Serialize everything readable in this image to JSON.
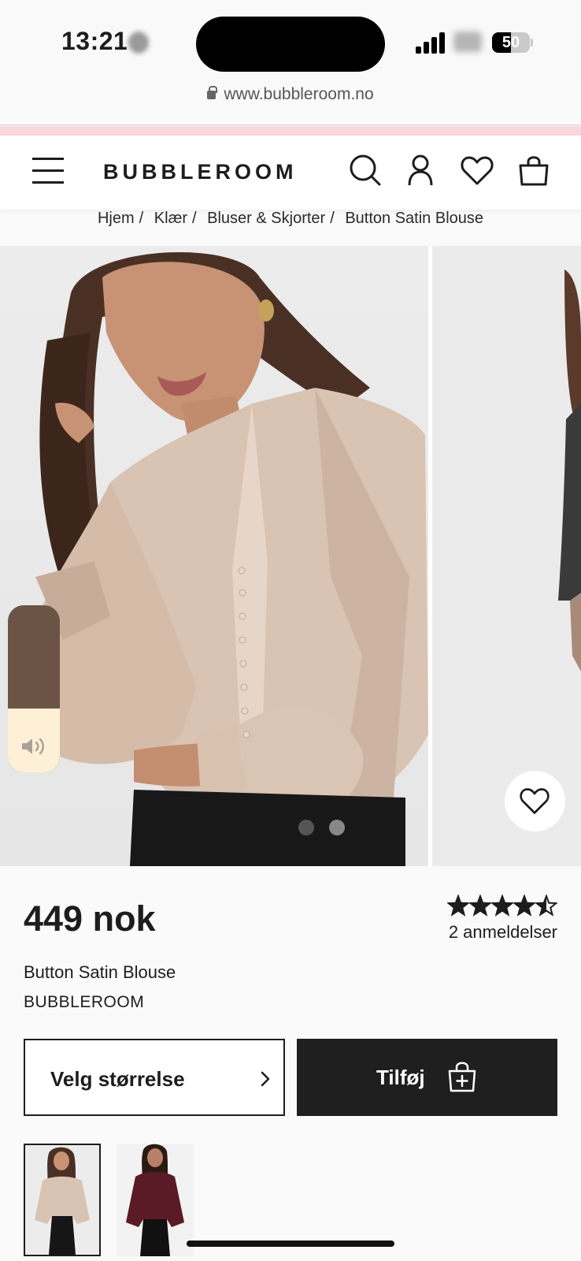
{
  "status_bar": {
    "time": "13:21",
    "battery_percent": "50",
    "battery_level": 0.5
  },
  "browser": {
    "url": "www.bubbleroom.no"
  },
  "header": {
    "logo": "BUBBLEROOM",
    "icons": [
      "menu-icon",
      "search-icon",
      "account-icon",
      "heart-icon",
      "shopping-bag-icon"
    ]
  },
  "breadcrumb": [
    "Hjem",
    "Klær",
    "Bluser & Skjorter",
    "Button Satin Blouse"
  ],
  "gallery": {
    "slide_count": 2,
    "active_slide": 1,
    "volume_level": 0.38
  },
  "product": {
    "price": "449 nok",
    "rating": 4.5,
    "reviews": "2 anmeldelser",
    "name": "Button Satin Blouse",
    "brand": "BUBBLEROOM",
    "size_button": "Velg størrelse",
    "add_button": "Tilføj"
  },
  "colors": {
    "accent_strip": "#f8d6dc",
    "button_dark": "#1f1f1f",
    "blouse": "#d9c3b3",
    "blouse_alt": "#5a1a26"
  },
  "thumbnails": [
    {
      "name": "thumb-champagne",
      "active": true
    },
    {
      "name": "thumb-burgundy",
      "active": false
    }
  ]
}
